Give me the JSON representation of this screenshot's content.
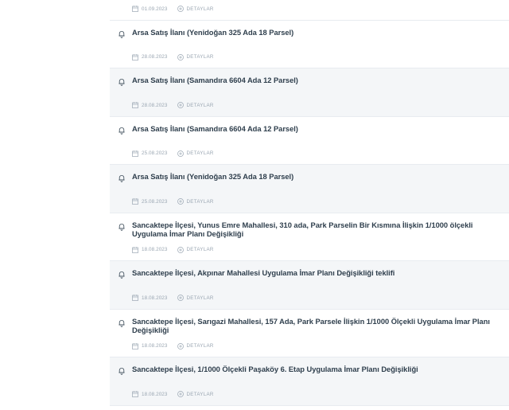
{
  "detail_label": "DETAYLAR",
  "items": [
    {
      "title": "",
      "date": "01.09.2023"
    },
    {
      "title": "Arsa Satış İlanı (Yenidoğan 325 Ada 18 Parsel)",
      "date": "28.08.2023"
    },
    {
      "title": "Arsa Satış İlanı (Samandıra 6604 Ada 12 Parsel)",
      "date": "28.08.2023"
    },
    {
      "title": "Arsa Satış İlanı (Samandıra 6604 Ada 12 Parsel)",
      "date": "25.08.2023"
    },
    {
      "title": "Arsa Satış İlanı (Yenidoğan 325 Ada 18 Parsel)",
      "date": "25.08.2023"
    },
    {
      "title": "Sancaktepe İlçesi, Yunus Emre Mahallesi, 310 ada, Park Parselin Bir Kısmına İlişkin 1/1000 ölçekli Uygulama İmar Planı Değişikliği",
      "date": "18.08.2023"
    },
    {
      "title": "Sancaktepe İlçesi, Akpınar Mahallesi Uygulama İmar Planı Değişikliği teklifi",
      "date": "18.08.2023"
    },
    {
      "title": "Sancaktepe İlçesi, Sarıgazi Mahallesi, 157 Ada, Park Parsele İlişkin 1/1000 Ölçekli Uygulama İmar Planı Değişikliği",
      "date": "18.08.2023"
    },
    {
      "title": "Sancaktepe İlçesi, 1/1000 Ölçekli Paşaköy 6. Etap Uygulama İmar Planı Değişikliği",
      "date": "18.08.2023"
    }
  ]
}
